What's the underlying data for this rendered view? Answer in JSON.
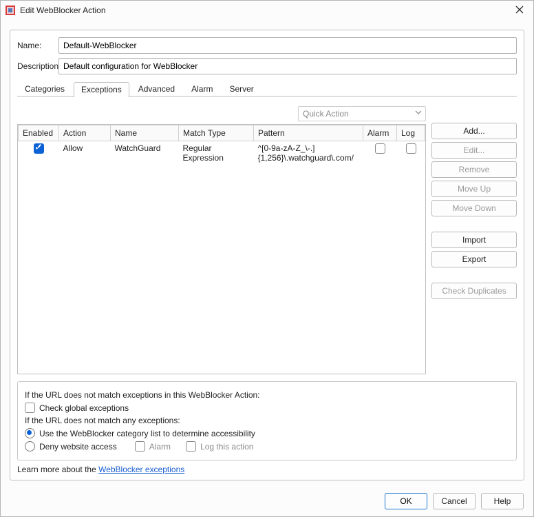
{
  "window": {
    "title": "Edit WebBlocker Action"
  },
  "form": {
    "name_label": "Name:",
    "name_value": "Default-WebBlocker",
    "desc_label": "Description:",
    "desc_value": "Default configuration for WebBlocker"
  },
  "tabs": [
    "Categories",
    "Exceptions",
    "Advanced",
    "Alarm",
    "Server"
  ],
  "active_tab": "Exceptions",
  "quick_action_label": "Quick Action",
  "columns": {
    "enabled": "Enabled",
    "action": "Action",
    "name": "Name",
    "match": "Match Type",
    "pattern": "Pattern",
    "alarm": "Alarm",
    "log": "Log"
  },
  "rows": [
    {
      "enabled": true,
      "action": "Allow",
      "name": "WatchGuard",
      "match": "Regular Expression",
      "pattern": "^[0-9a-zA-Z_\\-.]{1,256}\\.watchguard\\.com/",
      "alarm": false,
      "log": false
    }
  ],
  "side_buttons": {
    "add": "Add...",
    "edit": "Edit...",
    "remove": "Remove",
    "moveup": "Move Up",
    "movedown": "Move Down",
    "import": "Import",
    "export": "Export",
    "checkdup": "Check Duplicates"
  },
  "lower": {
    "l1": "If the URL does not match exceptions in this WebBlocker Action:",
    "chk_global": "Check global exceptions",
    "l2": "If the URL does not match any exceptions:",
    "r1": "Use the WebBlocker category list to determine accessibility",
    "r2": "Deny website access",
    "alarm": "Alarm",
    "log": "Log this action",
    "learn_prefix": "Learn more about the ",
    "learn_link": "WebBlocker exceptions"
  },
  "footer": {
    "ok": "OK",
    "cancel": "Cancel",
    "help": "Help"
  }
}
